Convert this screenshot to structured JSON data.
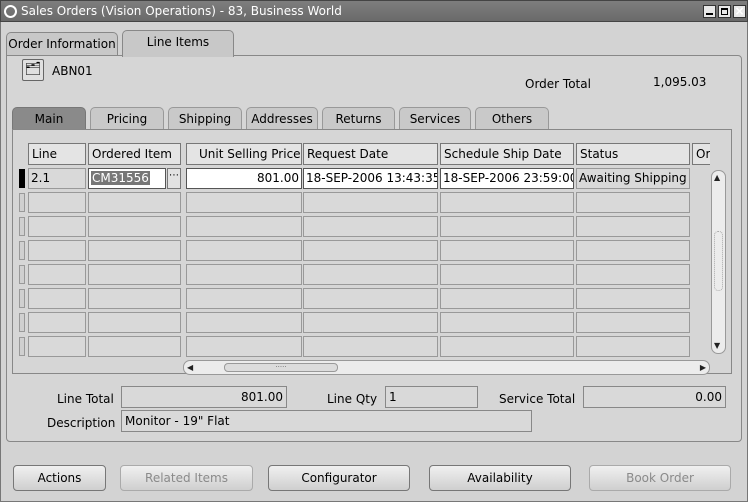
{
  "window": {
    "title": "Sales Orders (Vision Operations) - 83, Business World"
  },
  "top_tabs": [
    {
      "label": "Order Information",
      "active": false
    },
    {
      "label": "Line Items",
      "active": true
    }
  ],
  "header": {
    "customer_code": "ABN01",
    "order_total_label": "Order Total",
    "order_total_value": "1,095.03"
  },
  "sub_tabs": [
    {
      "label": "Main",
      "active": true
    },
    {
      "label": "Pricing"
    },
    {
      "label": "Shipping"
    },
    {
      "label": "Addresses"
    },
    {
      "label": "Returns"
    },
    {
      "label": "Services"
    },
    {
      "label": "Others"
    }
  ],
  "table": {
    "columns": [
      "Line",
      "Ordered Item",
      "Unit Selling Price",
      "Request Date",
      "Schedule Ship Date",
      "Status",
      "Or"
    ],
    "rows": [
      {
        "line": "2.1",
        "ordered_item": "CM31556",
        "unit_selling_price": "801.00",
        "request_date": "18-SEP-2006 13:43:35",
        "schedule_ship_date": "18-SEP-2006 23:59:00",
        "status": "Awaiting Shipping"
      }
    ],
    "lov_glyph": "⋯"
  },
  "footer": {
    "line_total_label": "Line Total",
    "line_total_value": "801.00",
    "line_qty_label": "Line Qty",
    "line_qty_value": "1",
    "service_total_label": "Service Total",
    "service_total_value": "0.00",
    "description_label": "Description",
    "description_value": "Monitor - 19\" Flat"
  },
  "buttons": [
    {
      "label": "Actions",
      "enabled": true
    },
    {
      "label": "Related Items",
      "enabled": false
    },
    {
      "label": "Configurator",
      "enabled": true
    },
    {
      "label": "Availability",
      "enabled": true
    },
    {
      "label": "Book Order",
      "enabled": false
    }
  ]
}
